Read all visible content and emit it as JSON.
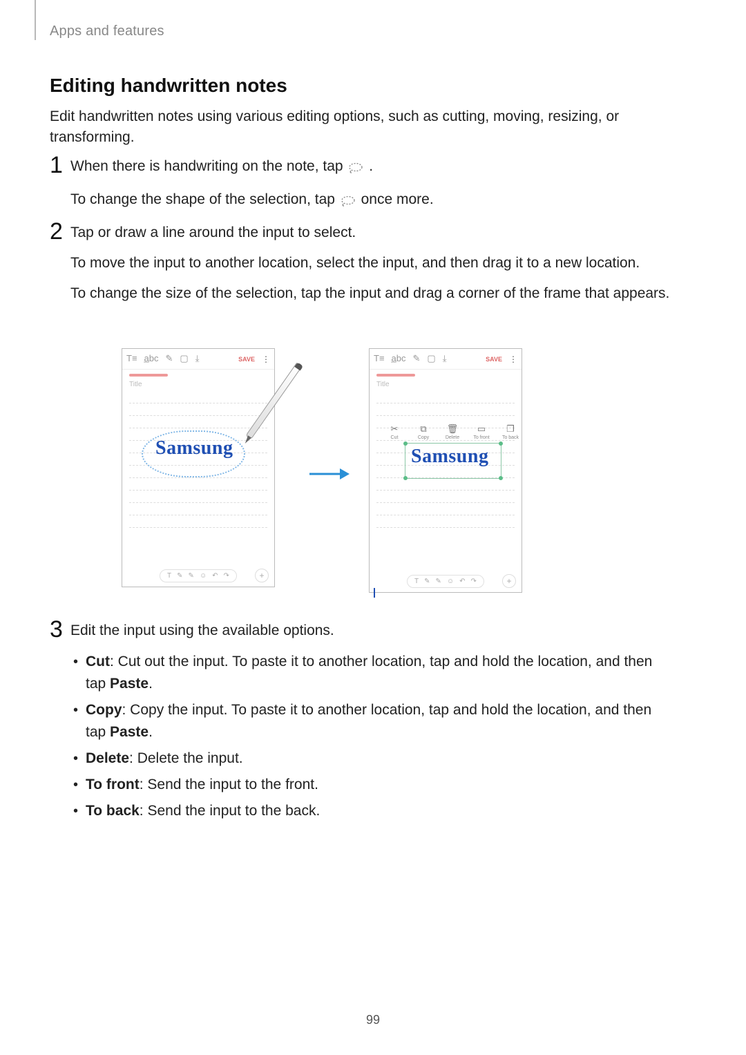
{
  "header": {
    "section": "Apps and features"
  },
  "h2": "Editing handwritten notes",
  "intro": "Edit handwritten notes using various editing options, such as cutting, moving, resizing, or transforming.",
  "step1": {
    "line1a": "When there is handwriting on the note, tap ",
    "line1b": ".",
    "line2a": "To change the shape of the selection, tap ",
    "line2b": " once more."
  },
  "step2": {
    "p1": "Tap or draw a line around the input to select.",
    "p2": "To move the input to another location, select the input, and then drag it to a new location.",
    "p3": "To change the size of the selection, tap the input and drag a corner of the frame that appears."
  },
  "step3": {
    "intro": "Edit the input using the available options.",
    "cut_label": "Cut",
    "cut_text": ": Cut out the input. To paste it to another location, tap and hold the location, and then tap ",
    "paste_label": "Paste",
    "cut_text2": ".",
    "copy_label": "Copy",
    "copy_text": ": Copy the input. To paste it to another location, tap and hold the location, and then tap ",
    "copy_text2": ".",
    "delete_label": "Delete",
    "delete_text": ": Delete the input.",
    "front_label": "To front",
    "front_text": ": Send the input to the front.",
    "back_label": "To back",
    "back_text": ": Send the input to the back."
  },
  "screenshot": {
    "text_glyph": "T≡",
    "abc_glyph": "a̲bc",
    "brush_glyph": "✎",
    "image_glyph": "▢",
    "mic_glyph": "⤓",
    "save": "SAVE",
    "menu_glyph": "⋮",
    "title_placeholder": "Title",
    "handwriting": "Samsung",
    "ctx": {
      "cut_glyph": "✂",
      "cut": "Cut",
      "copy_glyph": "⧉",
      "copy": "Copy",
      "delete_glyph": "🗑",
      "delete": "Delete",
      "front_glyph": "▭",
      "front": "To front",
      "back_glyph": "❐",
      "back": "To back"
    },
    "pill_icons": [
      "T",
      "✎",
      "✎",
      "☺",
      "↶",
      "↷"
    ],
    "plus": "+"
  },
  "page_number": "99"
}
